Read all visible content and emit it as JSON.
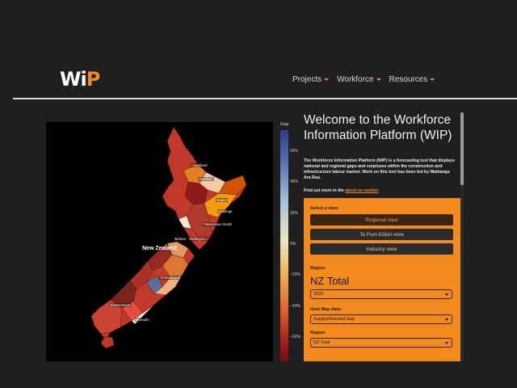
{
  "header": {
    "logo": {
      "wi": "Wi",
      "p": "P"
    },
    "nav": [
      {
        "label": "Projects"
      },
      {
        "label": "Workforce"
      },
      {
        "label": "Resources"
      }
    ],
    "accent": "#f28a1e"
  },
  "map": {
    "country_label": "New Zealand",
    "place_labels": [
      "Auckland",
      "Hamilton",
      "Napier",
      "Hastings",
      "Palmerston North",
      "Nelson",
      "Wellington",
      "Christchurch",
      "Queenstown",
      "Dunedin"
    ]
  },
  "legend": {
    "title": "Gap",
    "ticks": [
      "60%",
      "40%",
      "20%",
      "0%",
      "−20%",
      "−40%",
      "−60%"
    ]
  },
  "info": {
    "title": "Welcome to the Workforce Information Platform (WIP)",
    "description": "The Workforce Information Platform (WIP) is a forecasting tool that displays national and regional gaps and surpluses within the construction and infrastructure labour market. Work on this tool has been led by Waihanga Ara Rau.",
    "find_out_prefix": "Find out more in the",
    "find_out_link": "about us section"
  },
  "controls": {
    "select_view_label": "Select a view",
    "views": [
      {
        "label": "Regional view"
      },
      {
        "label": "Te Puni Kōkiri view"
      },
      {
        "label": "Industry view"
      }
    ],
    "region_label": "Region",
    "region_title": "NZ Total",
    "year_value": "2023",
    "heatmap_label": "Heat Map data:",
    "heatmap_value": "Supply/Demand Gap",
    "region2_label": "Region",
    "region2_value": "NZ Total"
  }
}
